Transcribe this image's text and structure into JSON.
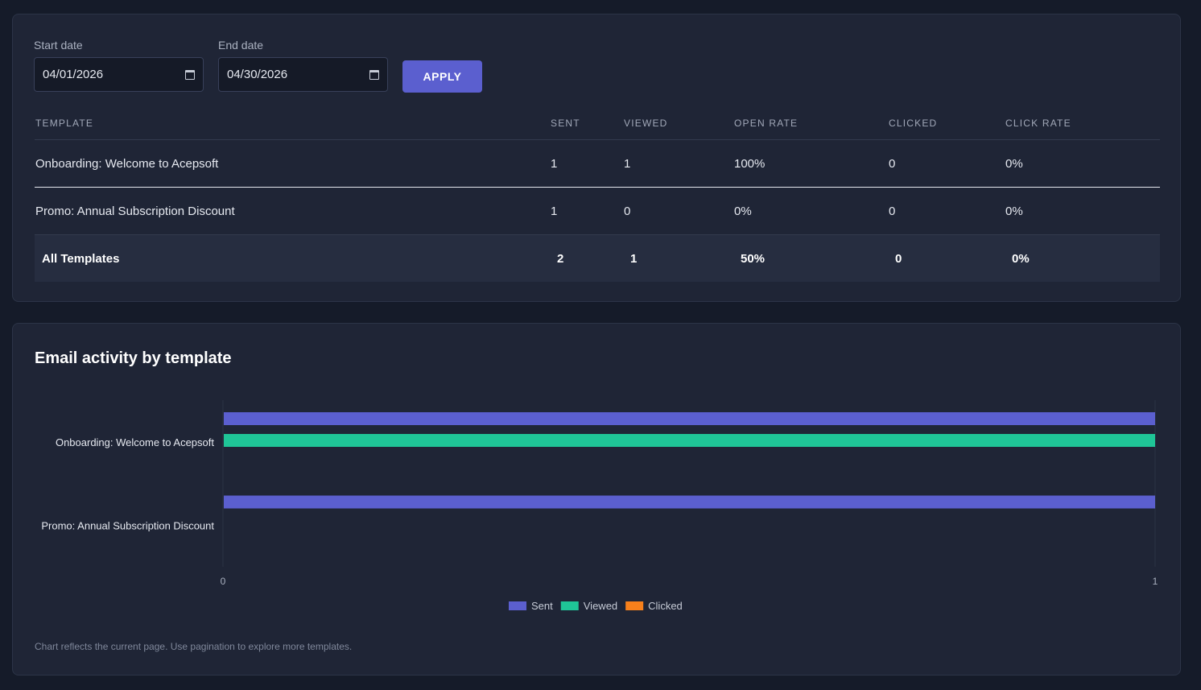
{
  "filters": {
    "start_label": "Start date",
    "start_value": "04/01/2026",
    "end_label": "End date",
    "end_value": "04/30/2026",
    "apply_label": "APPLY"
  },
  "table": {
    "headers": [
      "TEMPLATE",
      "SENT",
      "VIEWED",
      "OPEN RATE",
      "CLICKED",
      "CLICK RATE"
    ],
    "rows": [
      [
        "Onboarding: Welcome to Acepsoft",
        "1",
        "1",
        "100%",
        "0",
        "0%"
      ],
      [
        "Promo: Annual Subscription Discount",
        "1",
        "0",
        "0%",
        "0",
        "0%"
      ]
    ],
    "total": [
      "All Templates",
      "2",
      "1",
      "50%",
      "0",
      "0%"
    ]
  },
  "chart": {
    "title": "Email activity by template",
    "footnote": "Chart reflects the current page. Use pagination to explore more templates."
  },
  "chart_data": {
    "type": "bar",
    "orientation": "horizontal",
    "categories": [
      "Onboarding: Welcome to Acepsoft",
      "Promo: Annual Subscription Discount"
    ],
    "series": [
      {
        "name": "Sent",
        "values": [
          1,
          1
        ],
        "color": "#5b5fcf"
      },
      {
        "name": "Viewed",
        "values": [
          1,
          0
        ],
        "color": "#1fc597"
      },
      {
        "name": "Clicked",
        "values": [
          0,
          0
        ],
        "color": "#f7801b"
      }
    ],
    "xlim": [
      0,
      1
    ],
    "x_ticks": [
      "0",
      "1"
    ],
    "legend": "bottom-center",
    "grid": false
  }
}
